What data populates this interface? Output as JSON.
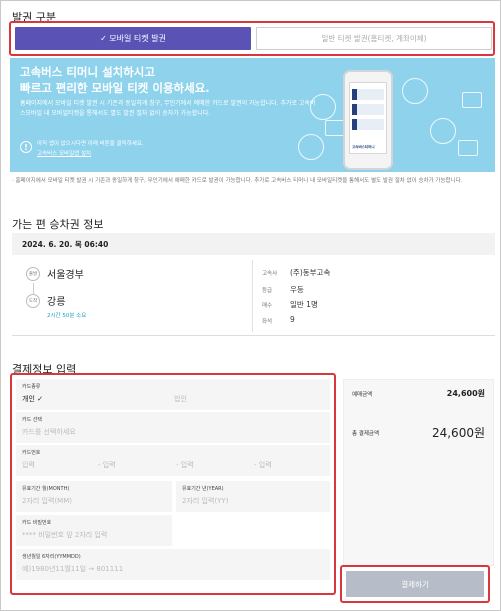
{
  "issue": {
    "section_title": "발권 구분",
    "mobile_button": "✓ 모바일 티켓 발권",
    "general_button": "일반 티켓 발권(홈티켓, 계좌이체)"
  },
  "banner": {
    "title_line1": "고속버스 티머니 설치하시고",
    "title_line2": "빠르고 편리한 모바일 티켓 이용하세요.",
    "desc": "홈페이지에서 모바일 티켓 발권 시 기존과 동일하게 창구, 무인기에서 예매한 카드로 발권이 가능합니다. 추가로 고속버스모바일 내 모바일티켓을 통해서도 별도 발권 절차 없이 승차가 가능합니다.",
    "note_line1": "아직 앱이 없으시다면 아래 버튼을 클릭하세요.",
    "note_link": "고속버스 모바일앱 설치",
    "phone_label": "고속버스티머니"
  },
  "footnote": "· 홈페이지에서 모바일 티켓 발권 시 기존과 동일하게 창구, 무인기에서 예매한 카드로 발권이 가능합니다. 추가로 고속버스 티머니 내 모바일티켓을 통해서도 별도 발권 절차 없이 승차가 가능합니다.",
  "trip": {
    "section_title": "가는 편 승차권 정보",
    "date": "2024. 6. 20. 목 06:40",
    "depart_badge": "출발",
    "arrive_badge": "도착",
    "depart_place": "서울경부",
    "arrive_place": "강릉",
    "duration": "2시간 50분 소요",
    "info": [
      {
        "label": "고속사",
        "value": "(주)동부고속"
      },
      {
        "label": "등급",
        "value": "우등"
      },
      {
        "label": "매수",
        "value": "일반 1명"
      },
      {
        "label": "좌석",
        "value": "9"
      }
    ]
  },
  "payment": {
    "section_title": "결제정보 입력",
    "card_type_label": "카드종류",
    "card_type_personal": "개인 ✓",
    "card_type_corporate": "법인",
    "card_select_label": "카드 선택",
    "card_select_placeholder": "카드를 선택하세요",
    "card_number_label": "카드번호",
    "card_number_placeholders": [
      "입력",
      "- 입력",
      "- 입력",
      "- 입력"
    ],
    "expiry_month_label": "유효기간 월(MONTH)",
    "expiry_month_placeholder": "2자리 입력(MM)",
    "expiry_year_label": "유효기간 년(YEAR)",
    "expiry_year_placeholder": "2자리 입력(YY)",
    "password_label": "카드 비밀번호",
    "password_placeholder": "**** 비밀번호 앞 2자리 입력",
    "birth_label": "생년월일 6자리(YYMMDD)",
    "birth_placeholder": "예)1980년11월11일 → 801111"
  },
  "summary": {
    "reserve_label": "예매금액",
    "reserve_amount": "24,600원",
    "total_label": "총 결제금액",
    "total_amount": "24,600원"
  },
  "pay_button": "결제하기",
  "colors": {
    "accent": "#5a52b5",
    "highlight": "#d9363e",
    "banner": "#8fd2ec",
    "link": "#1aa0c8"
  }
}
